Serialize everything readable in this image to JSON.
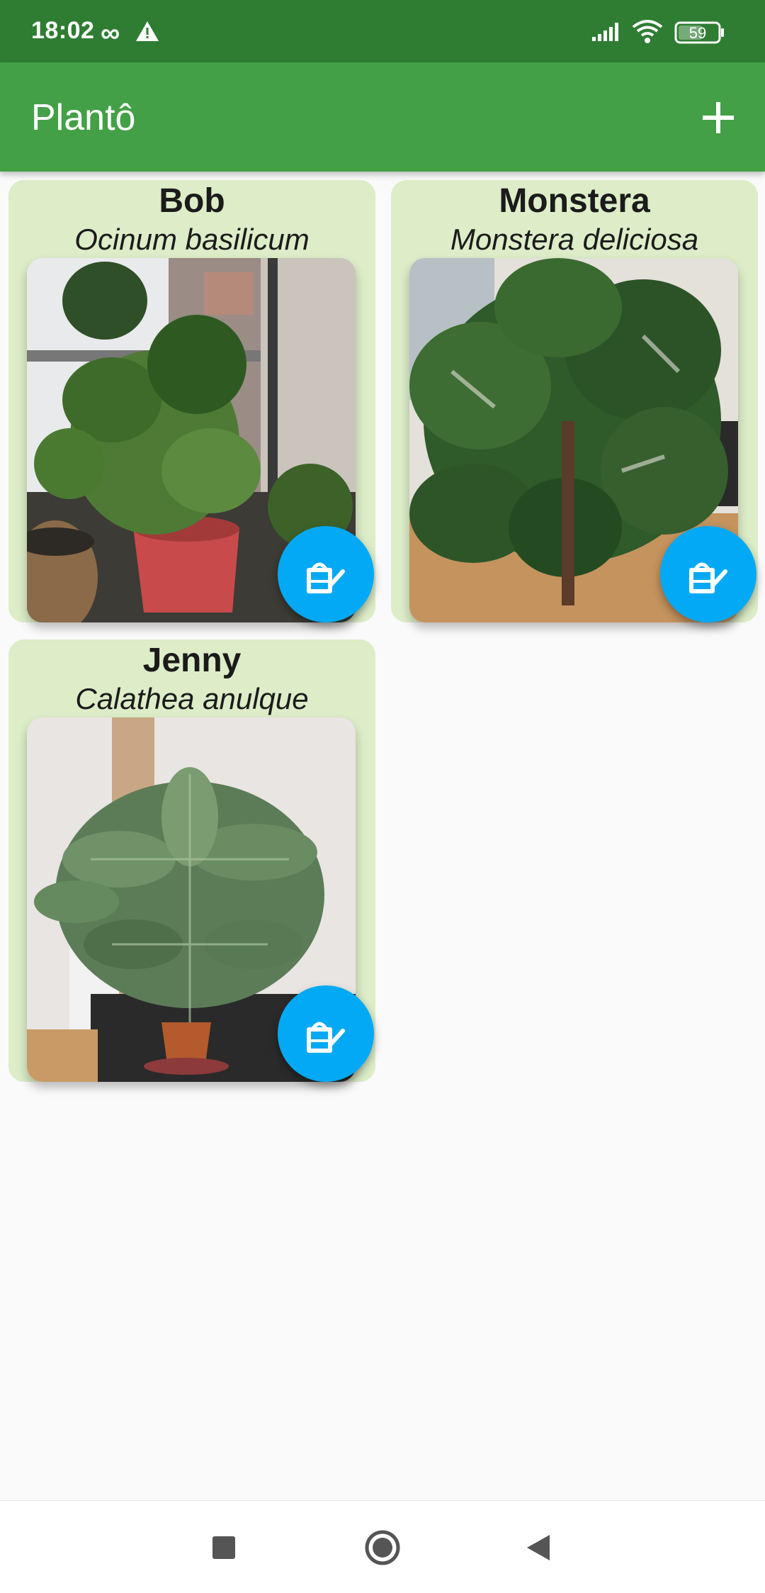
{
  "status_bar": {
    "time": "18:02",
    "infinity_symbol": "∞",
    "warning_icon": "warning-icon",
    "signal_icon": "cell-signal-icon",
    "wifi_icon": "wifi-icon",
    "battery_level": "59"
  },
  "app_bar": {
    "title": "Plantô",
    "add_icon": "plus-icon"
  },
  "plants": [
    {
      "name": "Bob",
      "species": "Ocinum basilicum",
      "photo": "basil-plant-photo",
      "action_icon": "watering-can-icon"
    },
    {
      "name": "Monstera",
      "species": "Monstera deliciosa",
      "photo": "monstera-plant-photo",
      "action_icon": "watering-can-icon"
    },
    {
      "name": "Jenny",
      "species": "Calathea anulque",
      "photo": "calathea-plant-photo",
      "action_icon": "watering-can-icon"
    }
  ],
  "colors": {
    "status_bar": "#2e7d32",
    "app_bar": "#43a047",
    "card": "#dcedc8",
    "fab": "#03a9f4",
    "background": "#fafafa"
  },
  "nav_bar": {
    "recents_icon": "recents-square-icon",
    "home_icon": "home-circle-icon",
    "back_icon": "back-triangle-icon"
  }
}
